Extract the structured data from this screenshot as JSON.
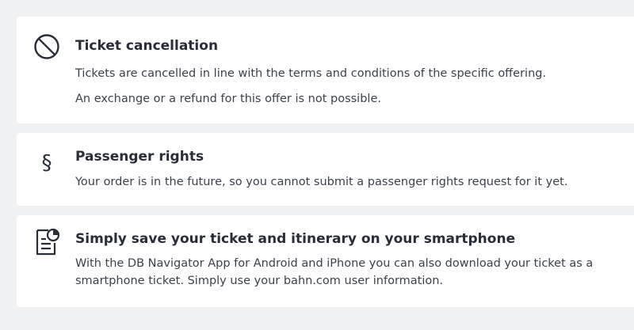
{
  "cancellation": {
    "icon": "prohibited-icon",
    "title": "Ticket cancellation",
    "text1": "Tickets are cancelled in line with the terms and conditions of the specific offering.",
    "text2": "An exchange or a refund for this offer is not possible."
  },
  "passenger_rights": {
    "icon": "section-sign-icon",
    "icon_glyph": "§",
    "title": "Passenger rights",
    "text1": "Your order is in the future, so you cannot submit a passenger rights request for it yet."
  },
  "smartphone": {
    "icon": "ticket-document-icon",
    "title": "Simply save your ticket and itinerary on your smartphone",
    "text1": "With the DB Navigator App for Android and iPhone you can also download your ticket as a smartphone ticket. Simply use your bahn.com user information."
  }
}
